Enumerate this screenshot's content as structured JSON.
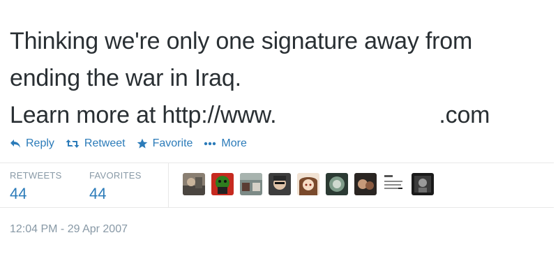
{
  "tweet": {
    "text_lines": [
      "Thinking we're only one signature away from",
      "ending the war in Iraq.",
      "Learn more at http://www."
    ],
    "url_suffix": ".com"
  },
  "actions": {
    "reply": "Reply",
    "retweet": "Retweet",
    "favorite": "Favorite",
    "more": "More"
  },
  "stats": {
    "retweets_label": "RETWEETS",
    "retweets_count": "44",
    "favorites_label": "FAVORITES",
    "favorites_count": "44"
  },
  "favoriters": [
    {
      "icon": "avatar-photo-1"
    },
    {
      "icon": "avatar-photo-2"
    },
    {
      "icon": "avatar-photo-3"
    },
    {
      "icon": "avatar-photo-4"
    },
    {
      "icon": "avatar-photo-5"
    },
    {
      "icon": "avatar-photo-6"
    },
    {
      "icon": "avatar-photo-7"
    },
    {
      "icon": "avatar-photo-8"
    },
    {
      "icon": "avatar-photo-9"
    }
  ],
  "timestamp": "12:04 PM - 29 Apr 2007",
  "colors": {
    "text": "#292f33",
    "link": "#2b7bb9",
    "muted": "#8899a6",
    "divider": "#e8e8e8"
  }
}
